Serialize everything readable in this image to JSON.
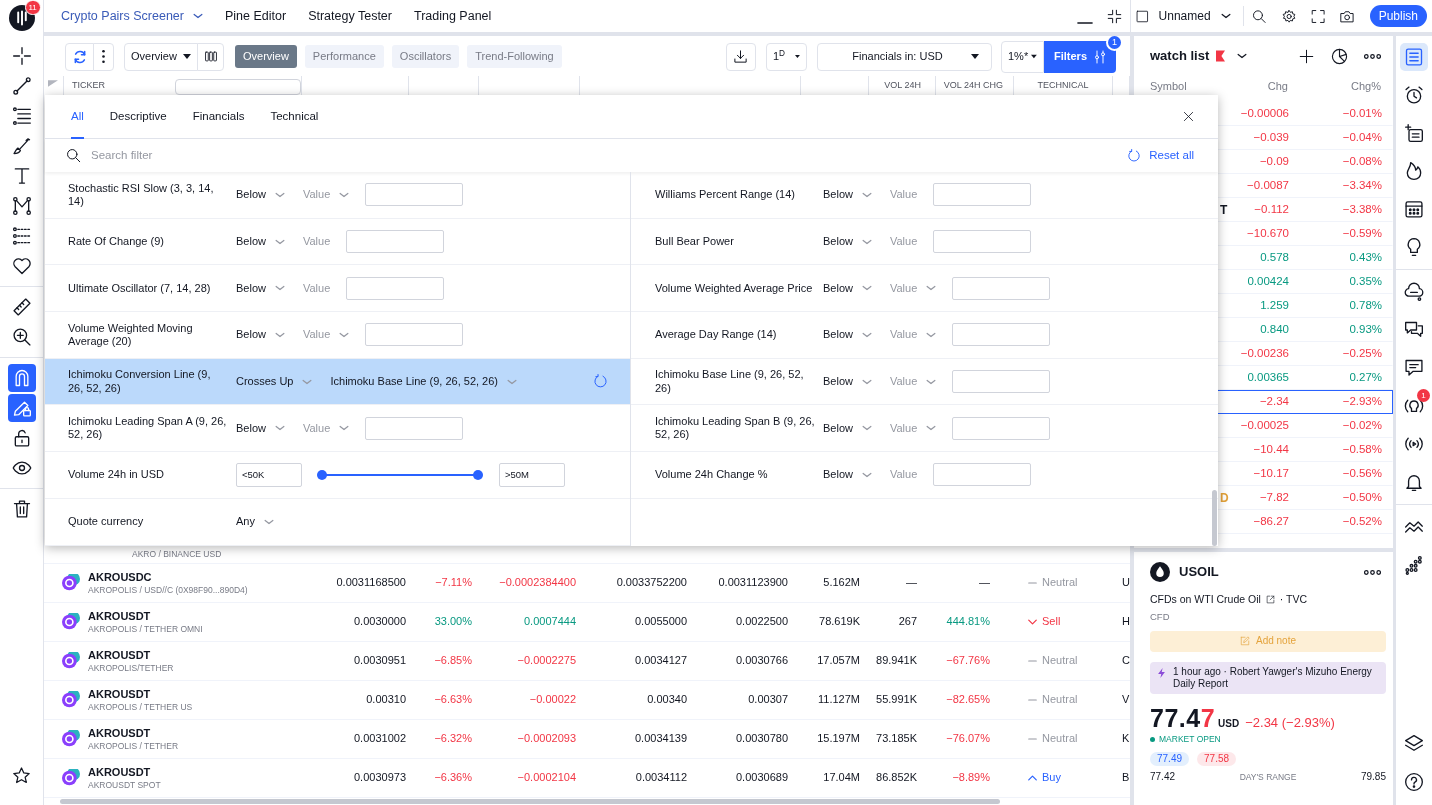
{
  "left_toolbar": {
    "logo_badge": "11",
    "tool_groups": [
      [
        {
          "kind": "crosshair",
          "on": false
        },
        {
          "kind": "line",
          "on": false
        },
        {
          "kind": "fib",
          "on": false
        },
        {
          "kind": "brush",
          "on": false
        },
        {
          "kind": "text",
          "on": false
        },
        {
          "kind": "pattern",
          "on": false
        },
        {
          "kind": "projection",
          "on": false
        },
        {
          "kind": "favorites",
          "on": false
        }
      ],
      [
        {
          "kind": "ruler",
          "on": false
        },
        {
          "kind": "zoom",
          "on": false
        }
      ],
      [
        {
          "kind": "magnet",
          "on": true
        },
        {
          "kind": "drawlock",
          "on": true
        },
        {
          "kind": "lock",
          "on": false
        },
        {
          "kind": "eye",
          "on": false
        }
      ],
      [
        {
          "kind": "trash",
          "on": false
        }
      ]
    ]
  },
  "top_tabs": [
    {
      "label": "Crypto Pairs Screener",
      "selected": true,
      "menu": true
    },
    {
      "label": "Pine Editor",
      "selected": false,
      "menu": false
    },
    {
      "label": "Strategy Tester",
      "selected": false,
      "menu": false
    },
    {
      "label": "Trading Panel",
      "selected": false,
      "menu": false
    }
  ],
  "top_right": {
    "layout_name": "Unnamed",
    "publish": "Publish"
  },
  "screener_toolbar": {
    "view_select": "Overview",
    "tabs": [
      {
        "label": "Overview",
        "selected": true
      },
      {
        "label": "Performance",
        "selected": false
      },
      {
        "label": "Oscillators",
        "selected": false
      },
      {
        "label": "Trend-Following",
        "selected": false
      }
    ],
    "interval": "1$^{D}$",
    "currency": "Financials in: USD",
    "precision": "1%*",
    "filters": "Filters",
    "filters_badge": "1"
  },
  "table": {
    "header": {
      "ticker": "TICKER",
      "vol": "VOL 24H",
      "vol_change": "VOL 24H CHG",
      "technical": "TECHNICAL"
    },
    "partial_row": {
      "description": "AKRO / BINANCE USD"
    },
    "rows": [
      {
        "ticker": "AKROUSDC",
        "description": "AKROPOLIS / USD//C (0X98F90...890D4)",
        "cells": [
          {
            "text": "0.0031168500",
            "kind": "plain"
          },
          {
            "text": "−7.11%",
            "kind": "down"
          },
          {
            "text": "−0.0002384400",
            "kind": "down"
          },
          {
            "text": "0.0033752200",
            "kind": "plain"
          },
          {
            "text": "0.0031123900",
            "kind": "plain"
          },
          {
            "text": "5.162M",
            "kind": "plain"
          },
          {
            "text": "—",
            "kind": "plain"
          },
          {
            "text": "—",
            "kind": "plain"
          }
        ],
        "technical": {
          "label": "Neutral",
          "kind": "neutral"
        },
        "column_11": "U"
      },
      {
        "ticker": "AKROUSDT",
        "description": "AKROPOLIS / TETHER OMNI",
        "cells": [
          {
            "text": "0.0030000",
            "kind": "plain"
          },
          {
            "text": "33.00%",
            "kind": "up"
          },
          {
            "text": "0.0007444",
            "kind": "up"
          },
          {
            "text": "0.0055000",
            "kind": "plain"
          },
          {
            "text": "0.0022500",
            "kind": "plain"
          },
          {
            "text": "78.619K",
            "kind": "plain"
          },
          {
            "text": "267",
            "kind": "plain"
          },
          {
            "text": "444.81%",
            "kind": "up"
          }
        ],
        "technical": {
          "label": "Sell",
          "kind": "sell"
        },
        "column_11": "H"
      },
      {
        "ticker": "AKROUSDT",
        "description": "AKROPOLIS/TETHER",
        "cells": [
          {
            "text": "0.0030951",
            "kind": "plain"
          },
          {
            "text": "−6.85%",
            "kind": "down"
          },
          {
            "text": "−0.0002275",
            "kind": "down"
          },
          {
            "text": "0.0034127",
            "kind": "plain"
          },
          {
            "text": "0.0030766",
            "kind": "plain"
          },
          {
            "text": "17.057M",
            "kind": "plain"
          },
          {
            "text": "89.941K",
            "kind": "plain"
          },
          {
            "text": "−67.76%",
            "kind": "down"
          }
        ],
        "technical": {
          "label": "Neutral",
          "kind": "neutral"
        },
        "column_11": "C"
      },
      {
        "ticker": "AKROUSDT",
        "description": "AKROPOLIS / TETHER US",
        "cells": [
          {
            "text": "0.00310",
            "kind": "plain"
          },
          {
            "text": "−6.63%",
            "kind": "down"
          },
          {
            "text": "−0.00022",
            "kind": "down"
          },
          {
            "text": "0.00340",
            "kind": "plain"
          },
          {
            "text": "0.00307",
            "kind": "plain"
          },
          {
            "text": "11.127M",
            "kind": "plain"
          },
          {
            "text": "55.991K",
            "kind": "plain"
          },
          {
            "text": "−82.65%",
            "kind": "down"
          }
        ],
        "technical": {
          "label": "Neutral",
          "kind": "neutral"
        },
        "column_11": "V"
      },
      {
        "ticker": "AKROUSDT",
        "description": "AKROPOLIS / TETHER",
        "cells": [
          {
            "text": "0.0031002",
            "kind": "plain"
          },
          {
            "text": "−6.32%",
            "kind": "down"
          },
          {
            "text": "−0.0002093",
            "kind": "down"
          },
          {
            "text": "0.0034139",
            "kind": "plain"
          },
          {
            "text": "0.0030780",
            "kind": "plain"
          },
          {
            "text": "15.197M",
            "kind": "plain"
          },
          {
            "text": "73.185K",
            "kind": "plain"
          },
          {
            "text": "−76.07%",
            "kind": "down"
          }
        ],
        "technical": {
          "label": "Neutral",
          "kind": "neutral"
        },
        "column_11": "K"
      },
      {
        "ticker": "AKROUSDT",
        "description": "AKROUSDT SPOT",
        "cells": [
          {
            "text": "0.0030973",
            "kind": "plain"
          },
          {
            "text": "−6.36%",
            "kind": "down"
          },
          {
            "text": "−0.0002104",
            "kind": "down"
          },
          {
            "text": "0.0034112",
            "kind": "plain"
          },
          {
            "text": "0.0030689",
            "kind": "plain"
          },
          {
            "text": "17.04M",
            "kind": "plain"
          },
          {
            "text": "86.852K",
            "kind": "plain"
          },
          {
            "text": "−8.89%",
            "kind": "down"
          }
        ],
        "technical": {
          "label": "Buy",
          "kind": "buy"
        },
        "column_11": "B"
      }
    ]
  },
  "filter_panel": {
    "tabs": [
      {
        "label": "All",
        "selected": true
      },
      {
        "label": "Descriptive",
        "selected": false
      },
      {
        "label": "Financials",
        "selected": false
      },
      {
        "label": "Technical",
        "selected": false
      }
    ],
    "search": {
      "placeholder": "Search filter"
    },
    "reset": "Reset all",
    "left": [
      {
        "kind": "compare",
        "label": "Stochastic RSI Slow (3, 3, 14, 14)",
        "operator": "Below",
        "value": "Value",
        "value_menu": true,
        "active": false
      },
      {
        "kind": "compare",
        "label": "Rate Of Change (9)",
        "operator": "Below",
        "value": "Value",
        "value_menu": false,
        "active": false
      },
      {
        "kind": "compare",
        "label": "Ultimate Oscillator (7, 14, 28)",
        "operator": "Below",
        "value": "Value",
        "value_menu": false,
        "active": false
      },
      {
        "kind": "compare",
        "label": "Volume Weighted Moving Average (20)",
        "operator": "Below",
        "value": "Value",
        "value_menu": true,
        "active": false
      },
      {
        "kind": "cross",
        "label": "Ichimoku Conversion Line (9, 26, 52, 26)",
        "operator": "Crosses Up",
        "value": "Ichimoku Base Line (9, 26, 52, 26)",
        "value_menu": true,
        "active": true
      },
      {
        "kind": "compare",
        "label": "Ichimoku Leading Span A (9, 26, 52, 26)",
        "operator": "Below",
        "value": "Value",
        "value_menu": true,
        "active": false
      },
      {
        "kind": "range",
        "label": "Volume 24h in USD",
        "min": "<50K",
        "max": ">50M",
        "thumbs": [
          {
            "level": 0
          },
          {
            "level": 1
          }
        ],
        "active": false
      },
      {
        "kind": "select",
        "label": "Quote currency",
        "operator": "Any",
        "active": false
      }
    ],
    "right": [
      {
        "kind": "compare",
        "label": "Williams Percent Range (14)",
        "operator": "Below",
        "value": "Value",
        "value_menu": false,
        "active": false
      },
      {
        "kind": "compare",
        "label": "Bull Bear Power",
        "operator": "Below",
        "value": "Value",
        "value_menu": false,
        "active": false
      },
      {
        "kind": "compare",
        "label": "Volume Weighted Average Price",
        "operator": "Below",
        "value": "Value",
        "value_menu": true,
        "active": false
      },
      {
        "kind": "compare",
        "label": "Average Day Range (14)",
        "operator": "Below",
        "value": "Value",
        "value_menu": true,
        "active": false
      },
      {
        "kind": "compare",
        "label": "Ichimoku Base Line (9, 26, 52, 26)",
        "operator": "Below",
        "value": "Value",
        "value_menu": true,
        "active": false
      },
      {
        "kind": "compare",
        "label": "Ichimoku Leading Span B (9, 26, 52, 26)",
        "operator": "Below",
        "value": "Value",
        "value_menu": true,
        "active": false
      },
      {
        "kind": "compare",
        "label": "Volume 24h Change %",
        "operator": "Below",
        "value": "Value",
        "value_menu": false,
        "active": false
      }
    ]
  },
  "watchlist": {
    "title": "watch list",
    "columns": [
      "Symbol",
      "Chg",
      "Chg%"
    ],
    "rows": [
      {
        "chg": "−0.00006",
        "chg_pct": "−0.01%",
        "kind": "down",
        "selected": false
      },
      {
        "chg": "−0.039",
        "chg_pct": "−0.04%",
        "kind": "down",
        "selected": false
      },
      {
        "chg": "−0.09",
        "chg_pct": "−0.08%",
        "kind": "down",
        "selected": false
      },
      {
        "chg": "−0.0087",
        "chg_pct": "−3.34%",
        "kind": "down",
        "selected": false
      },
      {
        "symbol": {
          "text": "T",
          "color": "#131722"
        },
        "chg": "−0.112",
        "chg_pct": "−3.38%",
        "kind": "down",
        "selected": false
      },
      {
        "chg": "−10.670",
        "chg_pct": "−0.59%",
        "kind": "down",
        "selected": false
      },
      {
        "chg": "0.578",
        "chg_pct": "0.43%",
        "kind": "up",
        "selected": false
      },
      {
        "chg": "0.00424",
        "chg_pct": "0.35%",
        "kind": "up",
        "selected": false
      },
      {
        "chg": "1.259",
        "chg_pct": "0.78%",
        "kind": "up",
        "selected": false
      },
      {
        "chg": "0.840",
        "chg_pct": "0.93%",
        "kind": "up",
        "selected": false
      },
      {
        "chg": "−0.00236",
        "chg_pct": "−0.25%",
        "kind": "down",
        "selected": false
      },
      {
        "chg": "0.00365",
        "chg_pct": "0.27%",
        "kind": "up",
        "selected": false
      },
      {
        "chg": "−2.34",
        "chg_pct": "−2.93%",
        "kind": "down",
        "selected": true
      },
      {
        "chg": "−0.00025",
        "chg_pct": "−0.02%",
        "kind": "down",
        "selected": false
      },
      {
        "chg": "−10.44",
        "chg_pct": "−0.58%",
        "kind": "down",
        "selected": false
      },
      {
        "chg": "−10.17",
        "chg_pct": "−0.56%",
        "kind": "down",
        "selected": false
      },
      {
        "symbol": {
          "text": "D",
          "color": "#e3a23a"
        },
        "chg": "−7.82",
        "chg_pct": "−0.50%",
        "kind": "down",
        "selected": false
      },
      {
        "chg": "−86.27",
        "chg_pct": "−0.52%",
        "kind": "down",
        "selected": false
      }
    ]
  },
  "details": {
    "symbol": "USOIL",
    "description": "CFDs on WTI Crude Oil",
    "source": "· TVC",
    "type": "CFD",
    "note_button": "Add note",
    "news": "1 hour ago · Robert Yawger's Mizuho Energy Daily Report",
    "price_parts": [
      {
        "text": "77.4",
        "kind": "steady"
      },
      {
        "text": "7",
        "kind": "changed"
      }
    ],
    "currency": "USD",
    "change": "−2.34 (−2.93%)",
    "market_status": "MARKET OPEN",
    "bid": "77.49",
    "ask": "77.58",
    "range_low": "77.42",
    "range_label": "DAY'S RANGE",
    "range_high": "79.85"
  },
  "right_bar": {
    "groups": [
      [
        {
          "kind": "watchlist",
          "selected": true
        },
        {
          "kind": "alarm",
          "selected": false
        },
        {
          "kind": "hotlist",
          "selected": false
        },
        {
          "kind": "fire",
          "selected": false
        },
        {
          "kind": "calendar",
          "selected": false
        },
        {
          "kind": "bulb",
          "selected": false
        }
      ],
      [
        {
          "kind": "minds",
          "selected": false
        },
        {
          "kind": "chats",
          "selected": false
        },
        {
          "kind": "chat",
          "selected": false
        },
        {
          "kind": "broadcast",
          "selected": false,
          "badge": "1"
        },
        {
          "kind": "stream",
          "selected": false
        },
        {
          "kind": "bell",
          "selected": false
        }
      ],
      [
        {
          "kind": "chevrons",
          "selected": false
        },
        {
          "kind": "dots",
          "selected": false
        }
      ]
    ],
    "bottom": [
      {
        "kind": "layers",
        "selected": false
      },
      {
        "kind": "help",
        "selected": false
      }
    ]
  }
}
